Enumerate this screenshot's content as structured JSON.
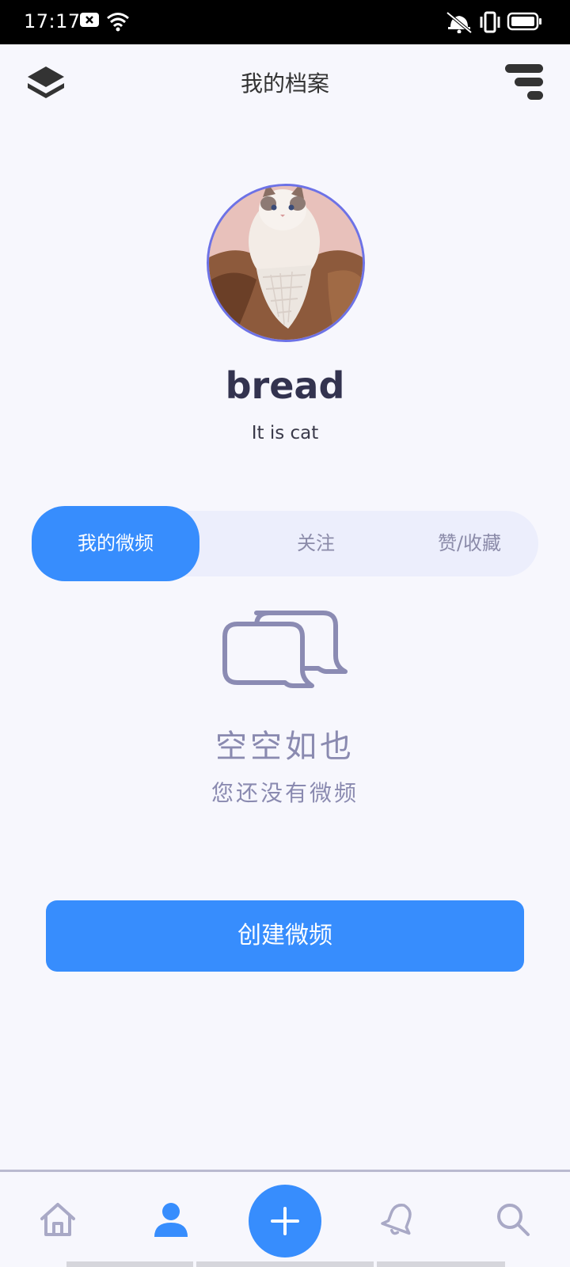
{
  "status_bar": {
    "time": "17:17",
    "icons": [
      "notification-x-icon",
      "wifi-icon",
      "vibrate-off-icon",
      "vibrate-icon",
      "battery-icon"
    ]
  },
  "header": {
    "title": "我的档案",
    "left_icon": "layers-icon",
    "right_icon": "filter-icon"
  },
  "profile": {
    "username": "bread",
    "bio": "It is cat",
    "avatar_border_color": "#6d72e6"
  },
  "tabs": [
    {
      "label": "我的微频",
      "active": true
    },
    {
      "label": "关注",
      "active": false
    },
    {
      "label": "赞/收藏",
      "active": false
    }
  ],
  "empty_state": {
    "icon": "chat-bubbles-icon",
    "title": "空空如也",
    "subtitle": "您还没有微频"
  },
  "create_button": {
    "label": "创建微频"
  },
  "bottom_nav": {
    "items": [
      {
        "icon": "home-icon",
        "active": false
      },
      {
        "icon": "profile-icon",
        "active": true
      },
      {
        "icon": "plus-icon",
        "active": false
      },
      {
        "icon": "bell-icon",
        "active": false
      },
      {
        "icon": "search-icon",
        "active": false
      }
    ]
  },
  "colors": {
    "accent": "#378dfd",
    "background": "#f7f7fd",
    "muted": "#8a8ab0",
    "tab_track": "#eceefc",
    "inactive_nav": "#a9a9c6"
  }
}
